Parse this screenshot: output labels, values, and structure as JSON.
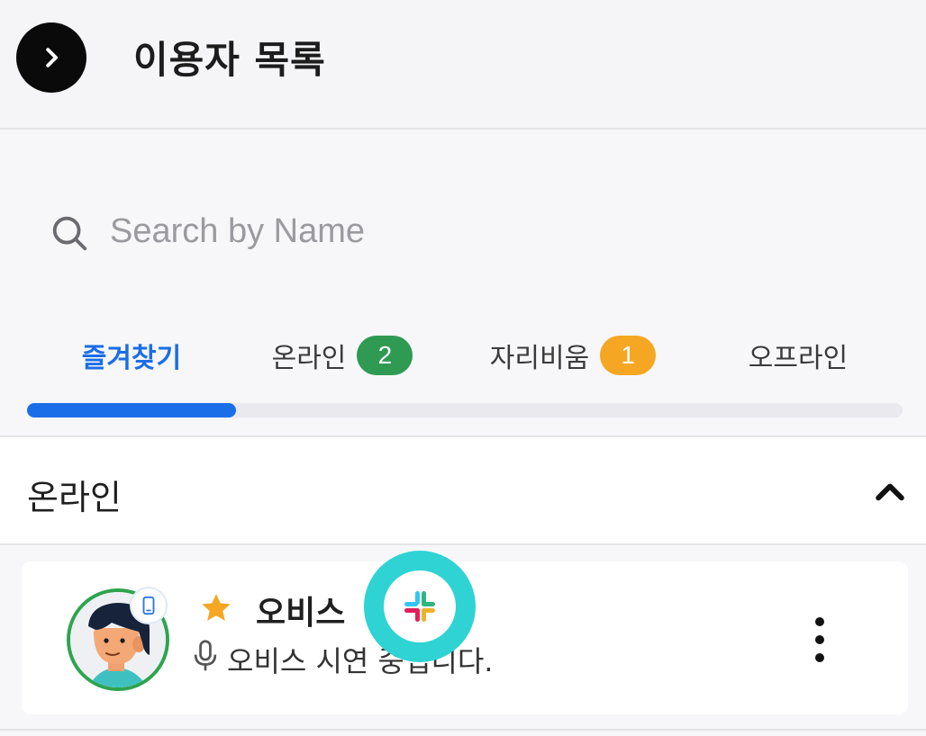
{
  "header": {
    "title": "이용자 목록",
    "toggle_icon": "chevron-right-icon"
  },
  "search": {
    "placeholder": "Search by Name",
    "value": "",
    "icon": "search-icon"
  },
  "tabs": [
    {
      "label": "즐겨찾기",
      "active": true,
      "badge": null
    },
    {
      "label": "온라인",
      "active": false,
      "badge": "2",
      "badge_color": "#2e9a52"
    },
    {
      "label": "자리비움",
      "active": false,
      "badge": "1",
      "badge_color": "#f5a623"
    },
    {
      "label": "오프라인",
      "active": false,
      "badge": null
    }
  ],
  "tab_indicator": {
    "active_index": 0,
    "color": "#1a6ee8"
  },
  "section": {
    "title": "온라인",
    "expanded": true,
    "toggle_icon": "chevron-up-icon"
  },
  "users": [
    {
      "name": "오비스",
      "status_text": "오비스 시연 중입니다.",
      "favorite": true,
      "presence": "online",
      "presence_color": "#2ea44f",
      "device_icon": "mobile-icon",
      "status_icon": "microphone-icon",
      "integration_icon": "slack-icon"
    }
  ],
  "colors": {
    "accent": "#1a6ee8",
    "online": "#2e9a52",
    "away": "#f5a623",
    "star": "#f5a623",
    "highlight": "#2fd3d3"
  }
}
